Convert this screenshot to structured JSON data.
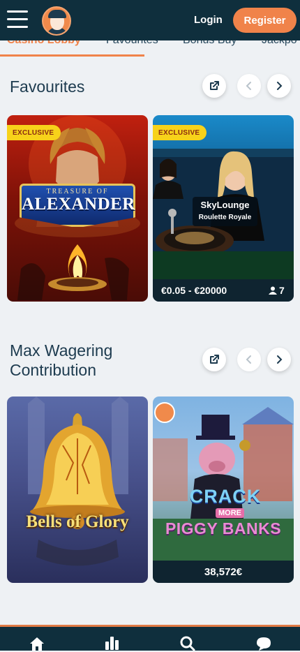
{
  "header": {
    "login_label": "Login",
    "register_label": "Register"
  },
  "tabs": [
    {
      "label": "Casino Lobby",
      "active": true
    },
    {
      "label": "Favourites"
    },
    {
      "label": "Bonus Buy"
    },
    {
      "label": "Jackpo"
    }
  ],
  "sections": [
    {
      "title": "Favourites",
      "games": [
        {
          "name": "Treasure of Alexander",
          "title_top": "TREASURE OF",
          "title_main": "ALEXANDER",
          "badge": "EXCLUSIVE"
        },
        {
          "name": "Sky Lounge Roulette Royale",
          "brand": "SkyLounge",
          "subtitle": "Roulette Royale",
          "badge": "EXCLUSIVE",
          "limits": "€0.05 - €20000",
          "players": "7"
        }
      ]
    },
    {
      "title": "Max Wagering Contribution",
      "games": [
        {
          "name": "Bells of Glory",
          "title_main": "Bells of Glory"
        },
        {
          "name": "Crack More Piggy Banks",
          "title_top": "CRACK",
          "title_mid": "MORE",
          "title_main": "PIGGY BANKS",
          "jackpot": "38,572€"
        }
      ]
    }
  ],
  "icons": {
    "menu": "hamburger-icon",
    "external": "external-link-icon",
    "prev": "chevron-left-icon",
    "next": "chevron-right-icon",
    "nav": [
      "home-icon",
      "stats-icon",
      "search-icon",
      "chat-icon"
    ]
  },
  "colors": {
    "brand_dark": "#0f2f3d",
    "accent": "#f0834a",
    "badge": "#f7d21a"
  }
}
